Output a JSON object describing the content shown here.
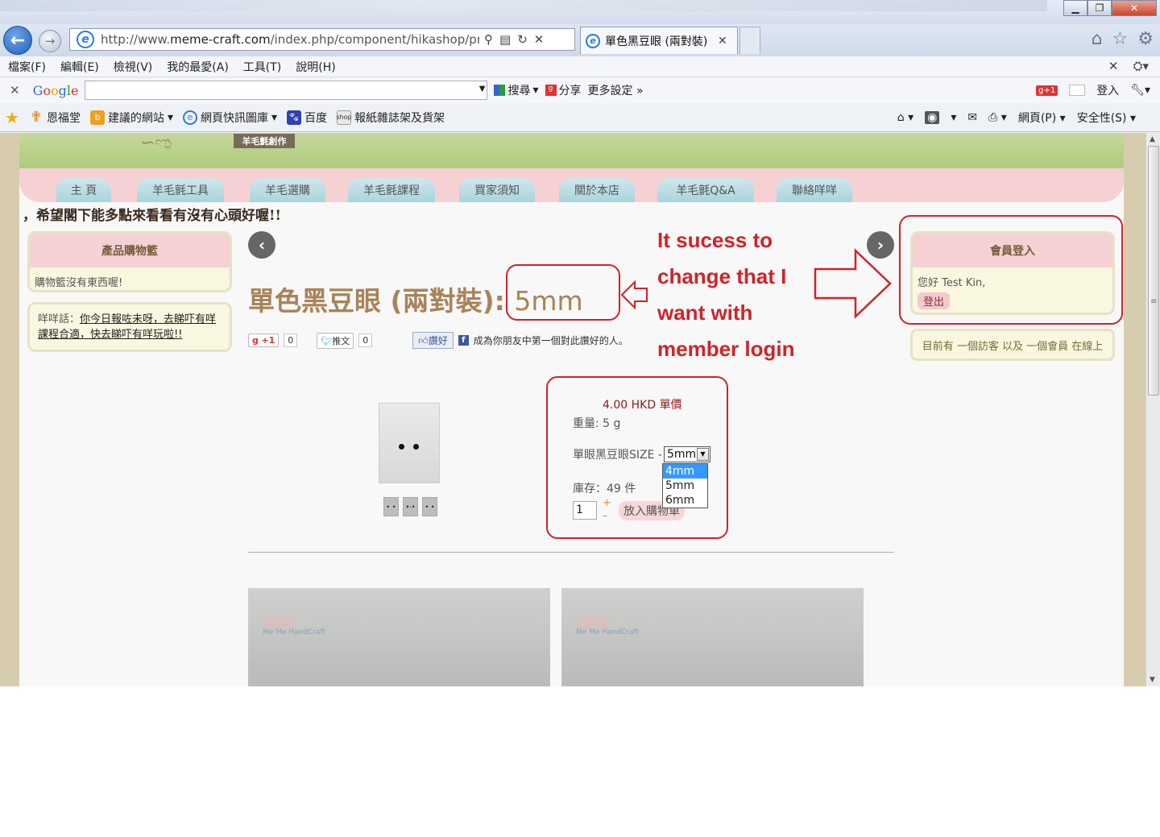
{
  "browser": {
    "url_prefix": "http://www.",
    "url_domain": "meme-craft.com",
    "url_rest": "/index.php/component/hikashop/prod",
    "tab_title": "單色黑豆眼 (兩對裝)",
    "menu": [
      "檔案(F)",
      "編輯(E)",
      "檢視(V)",
      "我的最愛(A)",
      "工具(T)",
      "說明(H)"
    ],
    "google": {
      "logo": "Google",
      "search": "搜尋",
      "share": "分享",
      "more": "更多設定 »",
      "signin": "登入"
    },
    "favorites": [
      {
        "label": "恩福堂",
        "icon": "cross-icon"
      },
      {
        "label": "建議的網站",
        "icon": "suggested-sites-icon",
        "dropdown": true
      },
      {
        "label": "網頁快訊圖庫",
        "icon": "web-slice-icon",
        "dropdown": true
      },
      {
        "label": "百度",
        "icon": "baidu-icon"
      },
      {
        "label": "報紙雜誌架及貨架",
        "icon": "shop-icon"
      }
    ],
    "cmdbar": {
      "page": "網頁(P)",
      "safety": "安全性(S)"
    }
  },
  "site": {
    "nav": [
      "主 頁",
      "羊毛氈工具",
      "羊毛選購",
      "羊毛氈課程",
      "買家須知",
      "關於本店",
      "羊毛氈Q&A",
      "聯絡咩咩"
    ],
    "logo_tag": "羊毛氈創作",
    "slogan": "，希望閣下能多點來看看有沒有心頭好喔!!",
    "cart": {
      "title": "產品購物籃",
      "empty": "購物籃沒有東西喔!"
    },
    "tip": {
      "prefix": "咩咩話：",
      "link": "你今日報咗未呀，去睇吓有咩課程合適，快去睇吓有咩玩啦!!"
    },
    "member": {
      "title": "會員登入",
      "greeting": "您好 Test Kin,",
      "logout": "登出"
    },
    "online": "目前有 一個訪客 以及 一個會員 在線上"
  },
  "product": {
    "title": "單色黑豆眼 (兩對裝):",
    "size_suffix": "5mm",
    "social": {
      "gplus": "+1",
      "gplus_count": "0",
      "tweet": "推文",
      "tweet_count": "0",
      "like": "讚好",
      "like_text": "成為你朋友中第一個對此讚好的人。"
    },
    "price": "4.00 HKD 單價",
    "weight": "重量: 5 g",
    "size_label": "單眼黑豆眼SIZE - ",
    "size_selected": "5mm",
    "size_options": [
      "4mm",
      "5mm",
      "6mm"
    ],
    "size_highlighted": "4mm",
    "stock": "庫存：49 件",
    "qty": "1",
    "add_to_cart": "放入購物車",
    "photo_brand": "咩咩",
    "photo_brand_sub": "Me Me HandCraft"
  },
  "annotation": {
    "lines": [
      "It sucess to",
      "change that I",
      "want with",
      "member login"
    ],
    "color": "#d0232a"
  }
}
